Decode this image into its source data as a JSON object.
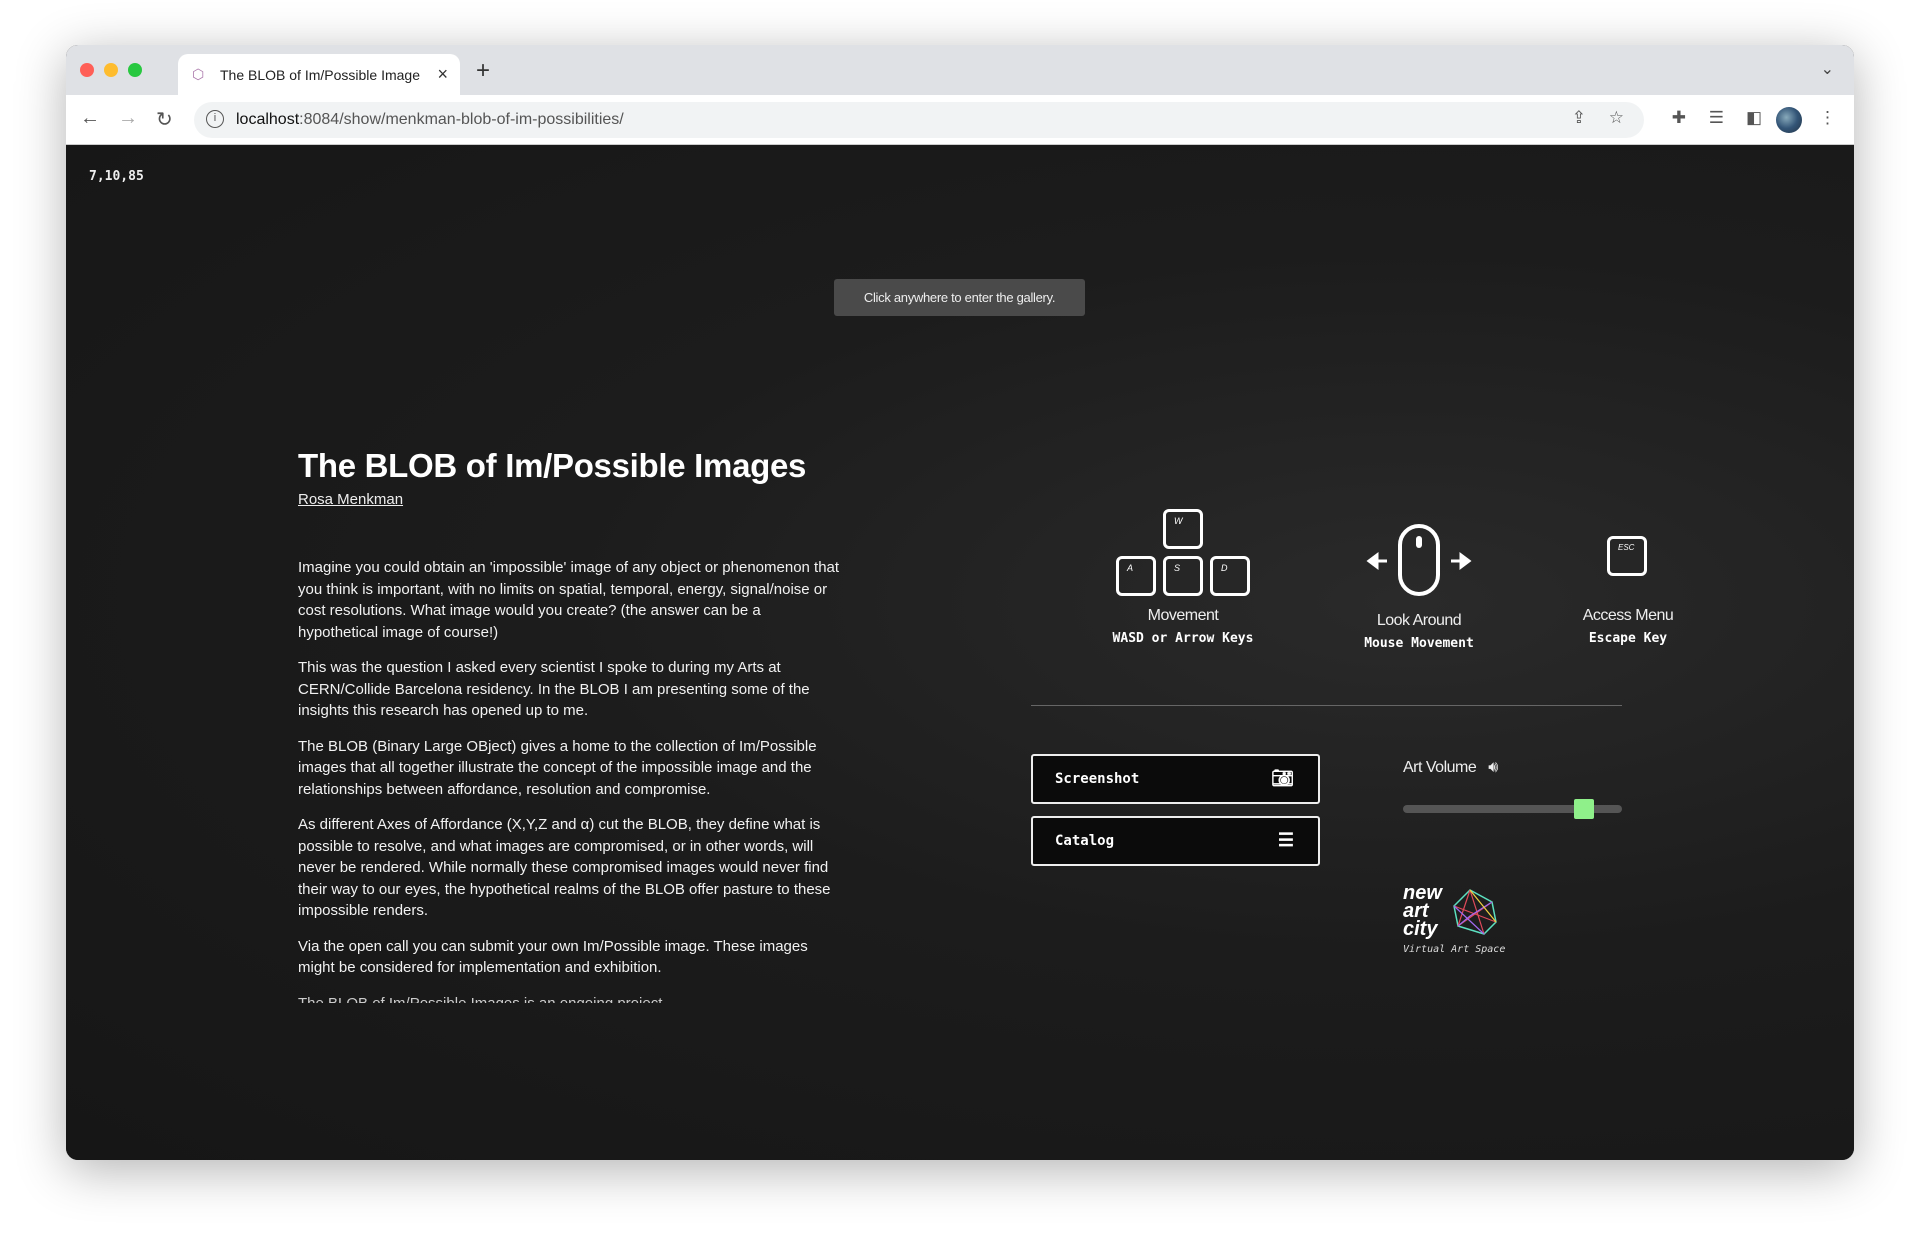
{
  "browser": {
    "tab_title": "The BLOB of Im/Possible Image",
    "url_host": "localhost",
    "url_path": ":8084/show/menkman-blob-of-im-possibilities/"
  },
  "page": {
    "coords": "7,10,85",
    "tooltip": "Click anywhere to enter the gallery.",
    "title": "The BLOB of Im/Possible Images",
    "author": "Rosa Menkman",
    "paragraphs": [
      "Imagine you could obtain an 'impossible' image of any object or phenomenon that you think is important, with no limits on spatial, temporal, energy, signal/noise or cost resolutions. What image would you create? (the answer can be a hypothetical image of course!)",
      "This was the question I asked every scientist I spoke to during my Arts at CERN/Collide Barcelona residency. In the BLOB I am presenting some of the insights this research has opened up to me.",
      "The BLOB (Binary Large OBject) gives a home to the collection of Im/Possible images that all together illustrate the concept of the impossible image and the relationships between affordance, resolution and compromise.",
      "As different Axes of Affordance (X,Y,Z and α) cut the BLOB, they define what is possible to resolve, and what images are compromised, or in other words, will never be rendered. While normally these compromised images would never find their way to our eyes, the hypothetical realms of the BLOB offer pasture to these impossible renders.",
      "Via the open call you can submit your own Im/Possible image. These images might be considered for implementation and exhibition."
    ],
    "cut_paragraph": "The BLOB of Im/Possible Images is an ongoing project"
  },
  "controls": {
    "movement": {
      "label": "Movement",
      "sub": "WASD or Arrow Keys",
      "keys": [
        "W",
        "A",
        "S",
        "D"
      ]
    },
    "look": {
      "label": "Look Around",
      "sub": "Mouse Movement"
    },
    "menu": {
      "label": "Access Menu",
      "sub": "Escape Key",
      "key": "ESC"
    }
  },
  "actions": {
    "screenshot": "Screenshot",
    "catalog": "Catalog"
  },
  "volume": {
    "label": "Art Volume",
    "level_percent": 86,
    "thumb_color": "#8ff08a"
  },
  "logo": {
    "name": "new art city",
    "tagline": "Virtual Art Space"
  }
}
